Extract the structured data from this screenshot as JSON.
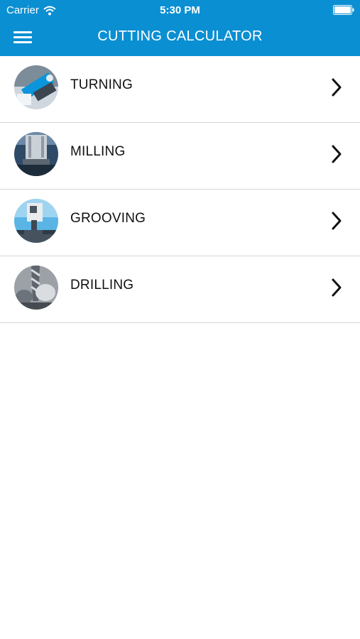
{
  "status_bar": {
    "carrier": "Carrier",
    "time": "5:30 PM",
    "icons": [
      "wifi-icon",
      "battery-icon"
    ]
  },
  "header": {
    "title": "CUTTING CALCULATOR",
    "menu_icon": "hamburger-menu-icon",
    "background_color": "#0a8fd2"
  },
  "menu_items": [
    {
      "label": "TURNING",
      "icon": "turning-thumbnail"
    },
    {
      "label": "MILLING",
      "icon": "milling-thumbnail"
    },
    {
      "label": "GROOVING",
      "icon": "grooving-thumbnail"
    },
    {
      "label": "DRILLING",
      "icon": "drilling-thumbnail"
    }
  ]
}
